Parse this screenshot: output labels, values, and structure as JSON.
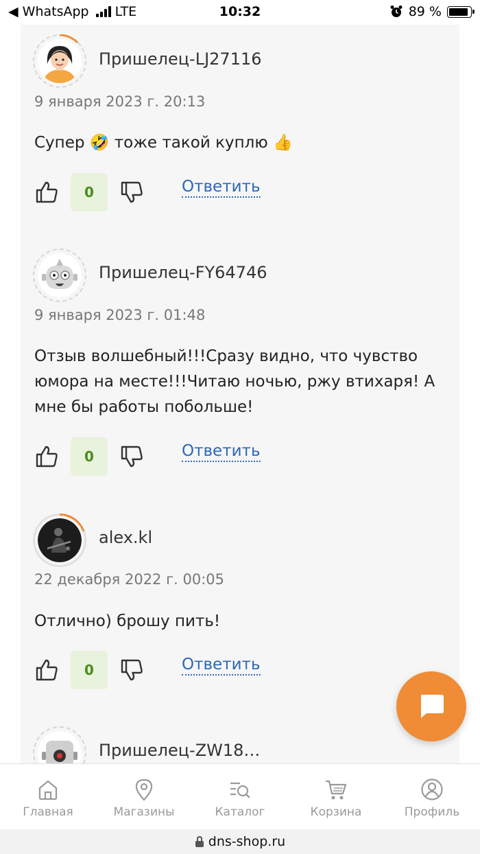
{
  "status_bar": {
    "back_app": "◀ WhatsApp",
    "carrier": "LTE",
    "time": "10:32",
    "battery": "89 %",
    "battery_level": 0.89
  },
  "comments": [
    {
      "author": "Пришелец-LJ27116",
      "date": "9 января 2023 г. 20:13",
      "text": "Супер 🤣 тоже такой куплю 👍",
      "score": "0",
      "reply_label": "Ответить",
      "avatar": "girl-avatar"
    },
    {
      "author": "Пришелец-FY64746",
      "date": "9 января 2023 г. 01:48",
      "text": "Отзыв волшебный!!!Сразу видно, что чувство юмора на месте!!!Читаю ночью, ржу втихаря! А мне бы работы побольше!",
      "score": "0",
      "reply_label": "Ответить",
      "avatar": "robot-avatar"
    },
    {
      "author": "alex.kl",
      "date": "22 декабря 2022 г. 00:05",
      "text": "Отлично) брошу пить!",
      "score": "0",
      "reply_label": "Ответить",
      "avatar": "photo-avatar"
    },
    {
      "author": "Пришелец-ZW18…",
      "avatar": "robot-avatar"
    }
  ],
  "nav": [
    {
      "label": "Главная",
      "icon": "home-icon"
    },
    {
      "label": "Магазины",
      "icon": "map-pin-icon"
    },
    {
      "label": "Каталог",
      "icon": "catalog-search-icon"
    },
    {
      "label": "Корзина",
      "icon": "cart-icon"
    },
    {
      "label": "Профиль",
      "icon": "profile-icon"
    }
  ],
  "url": "dns-shop.ru",
  "colors": {
    "accent": "#f08c35",
    "link": "#2c68b5",
    "score_bg": "#e8f2dc",
    "score_text": "#4d8a20"
  }
}
